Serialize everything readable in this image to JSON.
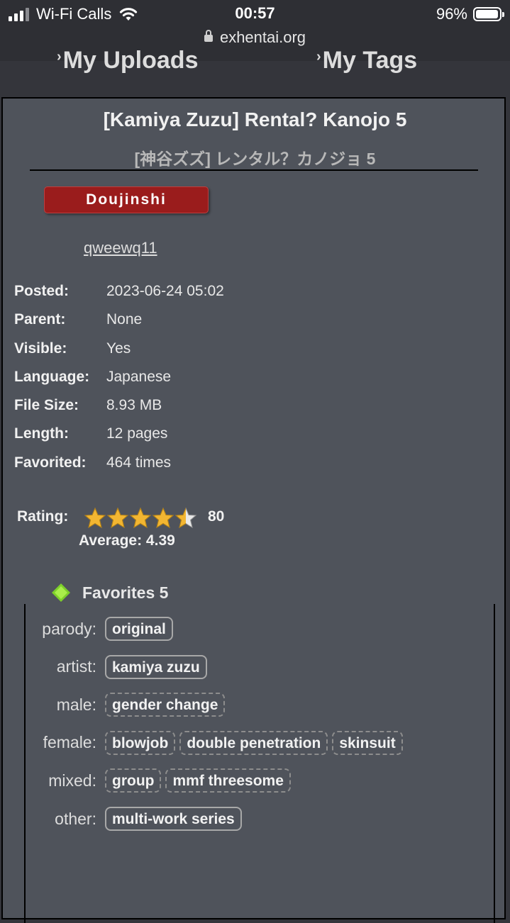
{
  "status_bar": {
    "carrier": "Wi-Fi Calls",
    "time": "00:57",
    "battery": "96%",
    "url": "exhentai.org"
  },
  "nav": {
    "uploads": "My Uploads",
    "tags": "My Tags"
  },
  "gallery": {
    "title": "[Kamiya Zuzu] Rental? Kanojo 5",
    "title_jp": "[神谷ズズ] レンタル？カノジョ 5",
    "category": "Doujinshi",
    "category_color": "#9a1c1c",
    "uploader": "qweewq11",
    "meta": [
      {
        "label": "Posted:",
        "value": "2023-06-24 05:02"
      },
      {
        "label": "Parent:",
        "value": "None"
      },
      {
        "label": "Visible:",
        "value": "Yes"
      },
      {
        "label": "Language:",
        "value": "Japanese"
      },
      {
        "label": "File Size:",
        "value": "8.93 MB"
      },
      {
        "label": "Length:",
        "value": "12 pages"
      },
      {
        "label": "Favorited:",
        "value": "464 times"
      }
    ],
    "rating": {
      "label": "Rating:",
      "count": "80",
      "average_text": "Average: 4.39",
      "stars_value": 4.5
    },
    "favorites": {
      "label": "Favorites 5",
      "icon": "green-diamond-icon"
    },
    "tags": [
      {
        "namespace": "parody:",
        "items": [
          {
            "text": "original",
            "weak": false
          }
        ]
      },
      {
        "namespace": "artist:",
        "items": [
          {
            "text": "kamiya zuzu",
            "weak": false
          }
        ]
      },
      {
        "namespace": "male:",
        "items": [
          {
            "text": "gender change",
            "weak": true
          }
        ]
      },
      {
        "namespace": "female:",
        "items": [
          {
            "text": "blowjob",
            "weak": true
          },
          {
            "text": "double penetration",
            "weak": true
          },
          {
            "text": "skinsuit",
            "weak": true
          }
        ]
      },
      {
        "namespace": "mixed:",
        "items": [
          {
            "text": "group",
            "weak": true
          },
          {
            "text": "mmf threesome",
            "weak": true
          }
        ]
      },
      {
        "namespace": "other:",
        "items": [
          {
            "text": "multi-work series",
            "weak": false
          }
        ]
      }
    ]
  }
}
